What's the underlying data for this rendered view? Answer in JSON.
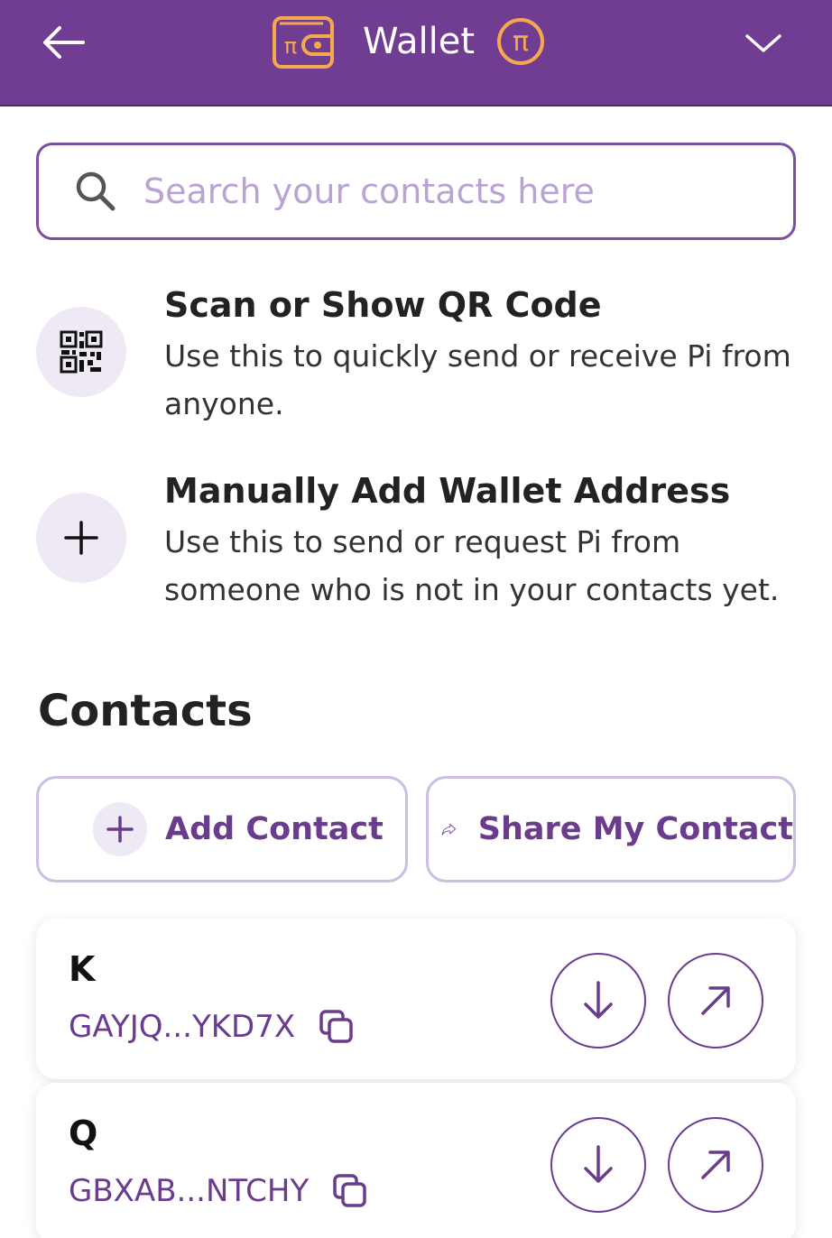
{
  "header": {
    "title": "Wallet",
    "back_icon": "arrow-left-icon",
    "logo_icon": "pi-wallet-icon",
    "coin_icon": "pi-coin-icon",
    "menu_icon": "chevron-down-icon",
    "colors": {
      "background": "#703d92",
      "accent": "#f6a94b"
    }
  },
  "search": {
    "placeholder": "Search your contacts here",
    "value": "",
    "icon": "search-icon"
  },
  "actions": [
    {
      "title": "Scan or Show QR Code",
      "description": "Use this to quickly send or receive Pi from anyone.",
      "icon": "qr-code-icon"
    },
    {
      "title": "Manually Add Wallet Address",
      "description": "Use this to send or request Pi from someone who is not in your contacts yet.",
      "icon": "plus-icon"
    }
  ],
  "contacts": {
    "heading": "Contacts",
    "add_label": "Add Contact",
    "share_label": "Share My Contact",
    "items": [
      {
        "name": "K",
        "address": "GAYJQ...YKD7X"
      },
      {
        "name": "Q",
        "address": "GBXAB...NTCHY"
      }
    ]
  }
}
